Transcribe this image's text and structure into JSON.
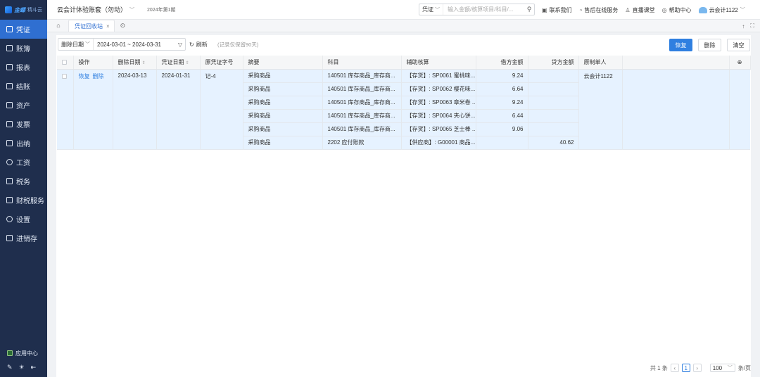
{
  "sidebar": {
    "logo_text": "金蝶",
    "logo_sub": "精斗云",
    "items": [
      {
        "label": "凭证",
        "active": true
      },
      {
        "label": "账簿"
      },
      {
        "label": "报表"
      },
      {
        "label": "结账"
      },
      {
        "label": "资产"
      },
      {
        "label": "发票"
      },
      {
        "label": "出纳"
      },
      {
        "label": "工资"
      },
      {
        "label": "税务"
      },
      {
        "label": "财税服务"
      },
      {
        "label": "设置"
      },
      {
        "label": "进销存"
      }
    ],
    "app_center": "应用中心"
  },
  "topbar": {
    "account_name": "云会计体验账套（勿动）",
    "period": "2024年第1期",
    "search_type": "凭证",
    "search_placeholder": "输入金额/核算项目/科目/...",
    "links": [
      "联系我们",
      "售后在线服务",
      "直播课堂",
      "帮助中心"
    ],
    "user": "云会计1122"
  },
  "tabs": {
    "active_tab": "凭证回收站"
  },
  "toolbar": {
    "filter_type": "删除日期",
    "date_range": "2024-03-01 ~ 2024-03-31",
    "refresh_label": "刷新",
    "note": "(记录仅保留90天)",
    "restore_label": "恢复",
    "delete_label": "删除",
    "clear_label": "清空"
  },
  "table": {
    "columns": [
      "操作",
      "删除日期",
      "凭证日期",
      "原凭证字号",
      "摘要",
      "科目",
      "辅助核算",
      "借方金额",
      "贷方金额",
      "原制单人"
    ],
    "ops": [
      "恢复",
      "删除"
    ],
    "voucher": {
      "delete_date": "2024-03-13",
      "voucher_date": "2024-01-31",
      "voucher_no": "记-4",
      "creator": "云会计1122"
    },
    "rows": [
      {
        "summary": "采购商品",
        "account": "140501 库存商品_库存商...",
        "aux": "【存货】: SP0061 蜜桃味...",
        "debit": "9.24",
        "credit": ""
      },
      {
        "summary": "采购商品",
        "account": "140501 库存商品_库存商...",
        "aux": "【存货】: SP0062 樱花味...",
        "debit": "6.64",
        "credit": ""
      },
      {
        "summary": "采购商品",
        "account": "140501 库存商品_库存商...",
        "aux": "【存货】: SP0063 章米卷 ...",
        "debit": "9.24",
        "credit": ""
      },
      {
        "summary": "采购商品",
        "account": "140501 库存商品_库存商...",
        "aux": "【存货】: SP0064 夹心饼...",
        "debit": "6.44",
        "credit": ""
      },
      {
        "summary": "采购商品",
        "account": "140501 库存商品_库存商...",
        "aux": "【存货】: SP0065 芝士棒 ...",
        "debit": "9.06",
        "credit": ""
      },
      {
        "summary": "采购商品",
        "account": "2202 应付账款",
        "aux": "【供应商】: G00001 商品...",
        "debit": "",
        "credit": "40.62"
      }
    ]
  },
  "pager": {
    "total": "共 1 条",
    "current_page": "1",
    "page_size": "100",
    "unit": "条/页"
  }
}
